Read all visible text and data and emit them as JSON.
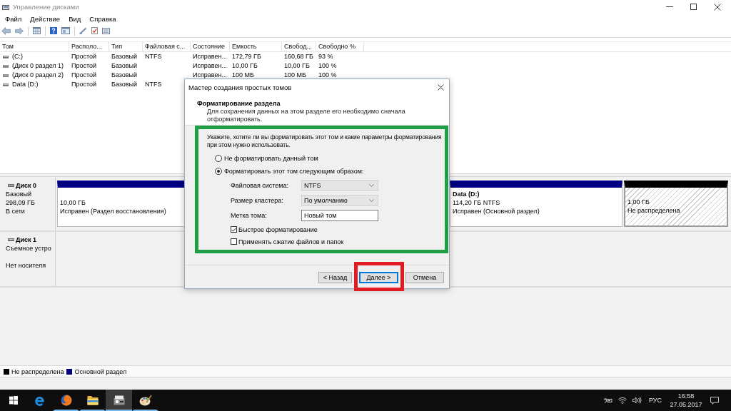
{
  "window": {
    "title": "Управление дисками"
  },
  "menu": [
    {
      "label": "Файл"
    },
    {
      "label": "Действие"
    },
    {
      "label": "Вид"
    },
    {
      "label": "Справка"
    }
  ],
  "volumes": {
    "columns": [
      "Том",
      "Располо...",
      "Тип",
      "Файловая с...",
      "Состояние",
      "Емкость",
      "Свобод...",
      "Свободно %"
    ],
    "rows": [
      {
        "volume": "(C:)",
        "layout": "Простой",
        "type": "Базовый",
        "file_system": "NTFS",
        "status": "Исправен...",
        "capacity": "172,79 ГБ",
        "free": "160,68 ГБ",
        "free_percent": "93 %"
      },
      {
        "volume": "(Диск 0 раздел 1)",
        "layout": "Простой",
        "type": "Базовый",
        "status": "Исправен...",
        "capacity": "10,00 ГБ",
        "free": "10,00 ГБ",
        "free_percent": "100 %"
      },
      {
        "volume": "(Диск 0 раздел 2)",
        "layout": "Простой",
        "type": "Базовый",
        "status": "Исправен...",
        "capacity": "100 МБ",
        "free": "100 МБ",
        "free_percent": "100 %"
      },
      {
        "volume": "Data (D:)",
        "layout": "Простой",
        "type": "Базовый",
        "file_system": "NTFS"
      }
    ]
  },
  "disks": [
    {
      "name": "Диск 0",
      "type": "Базовый",
      "size": "298,09 ГБ",
      "status": "В сети",
      "partitions": [
        {
          "kind": "primary",
          "size": "10,00 ГБ",
          "status": "Исправен (Раздел восстановления)"
        },
        {
          "kind": "primary",
          "label": "Data (D:)",
          "size": "114,20 ГБ NTFS",
          "status": "Исправен (Основной раздел)"
        },
        {
          "kind": "unallocated",
          "size": "1,00 ГБ",
          "status": "Не распределена"
        }
      ]
    },
    {
      "name": "Диск 1",
      "type": "Съемное устро",
      "status": "Нет носителя"
    }
  ],
  "legend": [
    {
      "label": "Не распределена",
      "color": "#000000"
    },
    {
      "label": "Основной раздел",
      "color": "#000080"
    }
  ],
  "dialog": {
    "title": "Мастер создания простых томов",
    "heading": "Форматирование раздела",
    "description": "Для сохранения данных на этом разделе его необходимо сначала отформатировать.",
    "options": {
      "highlighted": true,
      "prompt": "Укажите, хотите ли вы форматировать этот том и какие параметры форматирования при этом нужно использовать.",
      "radios": [
        {
          "label": "Не форматировать данный том",
          "selected": false
        },
        {
          "label": "Форматировать этот том следующим образом:",
          "selected": true
        }
      ],
      "fields": [
        {
          "kind": "dropdown",
          "label": "Файловая система:",
          "value": "NTFS"
        },
        {
          "kind": "dropdown",
          "label": "Размер кластера:",
          "value": "По умолчанию"
        },
        {
          "kind": "text",
          "label": "Метка тома:",
          "value": "Новый том"
        }
      ],
      "checkboxes": [
        {
          "label": "Быстрое форматирование",
          "checked": true
        },
        {
          "label": "Применять сжатие файлов и папок",
          "checked": false
        }
      ]
    },
    "buttons": [
      {
        "label": "< Назад",
        "default": false,
        "highlighted": false
      },
      {
        "label": "Далее >",
        "default": true,
        "highlighted": true
      },
      {
        "label": "Отмена",
        "default": false,
        "highlighted": false
      }
    ]
  },
  "taskbar": {
    "apps": [
      {
        "kind": "e_browser",
        "running": false,
        "selected": false
      },
      {
        "kind": "fox_browser",
        "running": true,
        "selected": false
      },
      {
        "kind": "folder",
        "running": true,
        "selected": false
      },
      {
        "kind": "disk",
        "running": true,
        "selected": true
      },
      {
        "kind": "palette",
        "running": true,
        "selected": false
      }
    ],
    "tray": {
      "language": "РУС",
      "time": "16:58",
      "date": "27.05.2017"
    }
  }
}
